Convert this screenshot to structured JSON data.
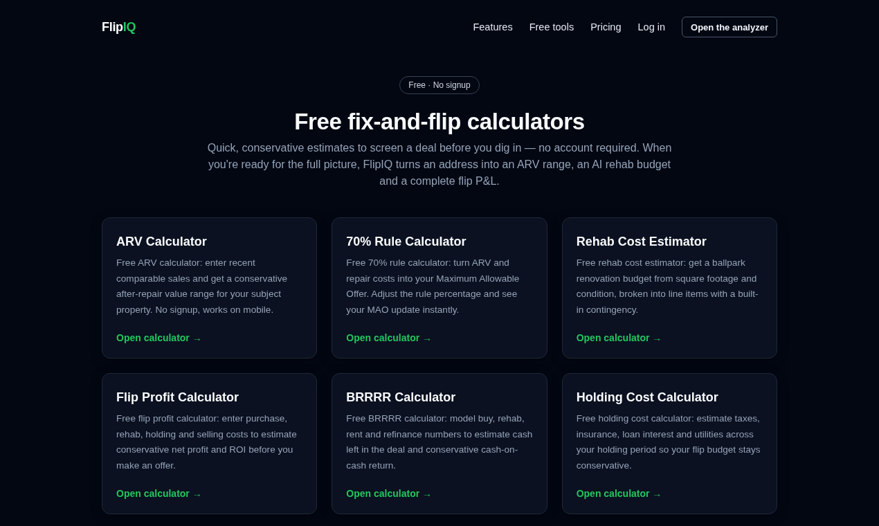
{
  "header": {
    "logo": {
      "name": "Flip",
      "accent": "IQ"
    },
    "nav": [
      "Features",
      "Free tools",
      "Pricing",
      "Log in"
    ],
    "cta": "Open the analyzer"
  },
  "hero": {
    "badge": "Free · No signup",
    "title": "Free fix-and-flip calculators",
    "subtitle": "Quick, conservative estimates to screen a deal before you dig in — no account required. When you're ready for the full picture, FlipIQ turns an address into an ARV range, an AI rehab budget and a complete flip P&L."
  },
  "cards": [
    {
      "title": "ARV Calculator",
      "description": "Free ARV calculator: enter recent comparable sales and get a conservative after-repair value range for your subject property. No signup, works on mobile.",
      "link": "Open calculator →"
    },
    {
      "title": "70% Rule Calculator",
      "description": "Free 70% rule calculator: turn ARV and repair costs into your Maximum Allowable Offer. Adjust the rule percentage and see your MAO update instantly.",
      "link": "Open calculator →"
    },
    {
      "title": "Rehab Cost Estimator",
      "description": "Free rehab cost estimator: get a ballpark renovation budget from square footage and condition, broken into line items with a built-in contingency.",
      "link": "Open calculator →"
    },
    {
      "title": "Flip Profit Calculator",
      "description": "Free flip profit calculator: enter purchase, rehab, holding and selling costs to estimate conservative net profit and ROI before you make an offer.",
      "link": "Open calculator →"
    },
    {
      "title": "BRRRR Calculator",
      "description": "Free BRRRR calculator: model buy, rehab, rent and refinance numbers to estimate cash left in the deal and conservative cash-on-cash return.",
      "link": "Open calculator →"
    },
    {
      "title": "Holding Cost Calculator",
      "description": "Free holding cost calculator: estimate taxes, insurance, loan interest and utilities across your holding period so your flip budget stays conservative.",
      "link": "Open calculator →"
    }
  ]
}
